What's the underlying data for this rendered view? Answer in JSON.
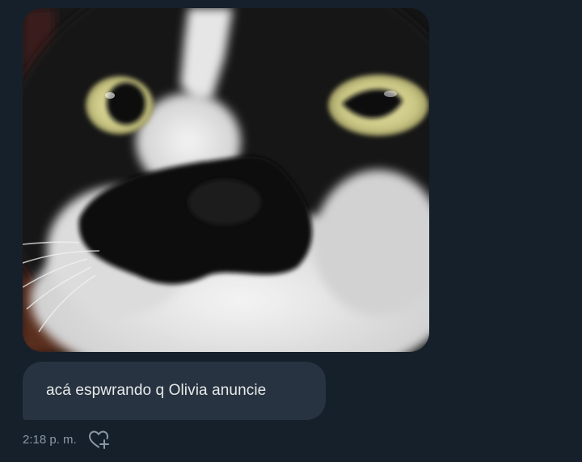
{
  "message": {
    "image_alt": "",
    "text": "acá espwrando q Olivia anuncie",
    "timestamp": "2:18 p. m."
  },
  "icons": {
    "reaction": "heart-plus-icon"
  },
  "colors": {
    "background": "#15202b",
    "bubble": "#273340",
    "text": "#e7e9ea",
    "meta": "#8b98a5"
  }
}
